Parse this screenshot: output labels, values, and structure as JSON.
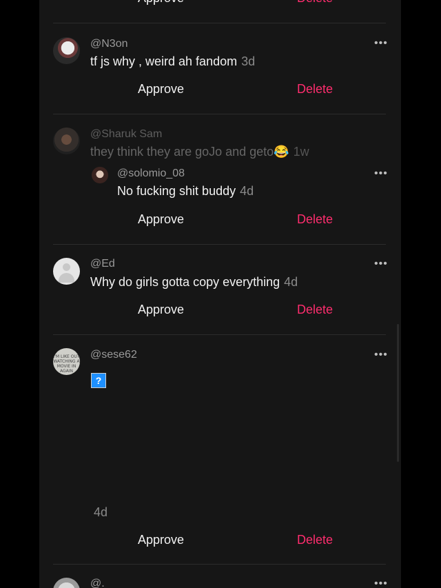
{
  "comments": [
    {
      "handle": "@N3on",
      "text": "tf js why , weird ah fandom",
      "age": "3d",
      "approve": "Approve",
      "delete": "Delete"
    },
    {
      "handle": "@Sharuk Sam",
      "text": "they think they are goJo and geto😂",
      "age": "1w",
      "reply": {
        "handle": "@solomio_08",
        "text": "No fucking shit buddy",
        "age": "4d",
        "approve": "Approve",
        "delete": "Delete"
      }
    },
    {
      "handle": "@Ed",
      "text": "Why do girls gotta copy everything",
      "age": "4d",
      "approve": "Approve",
      "delete": "Delete"
    },
    {
      "handle": "@sese62",
      "sticker": "?",
      "age": "4d",
      "approve": "Approve",
      "delete": "Delete",
      "avatar_text": "I'M LIKE OUT WATCHING A MOVIE IN AGAIN"
    },
    {
      "handle": "@."
    }
  ],
  "top_cut": {
    "approve": "Approve",
    "delete": "Delete"
  },
  "more_icon": "•••",
  "colors": {
    "background": "#161616",
    "page": "#000000",
    "delete_accent": "#ff2d6e",
    "handle": "#9a9a9a",
    "text": "#f2f2f2"
  }
}
